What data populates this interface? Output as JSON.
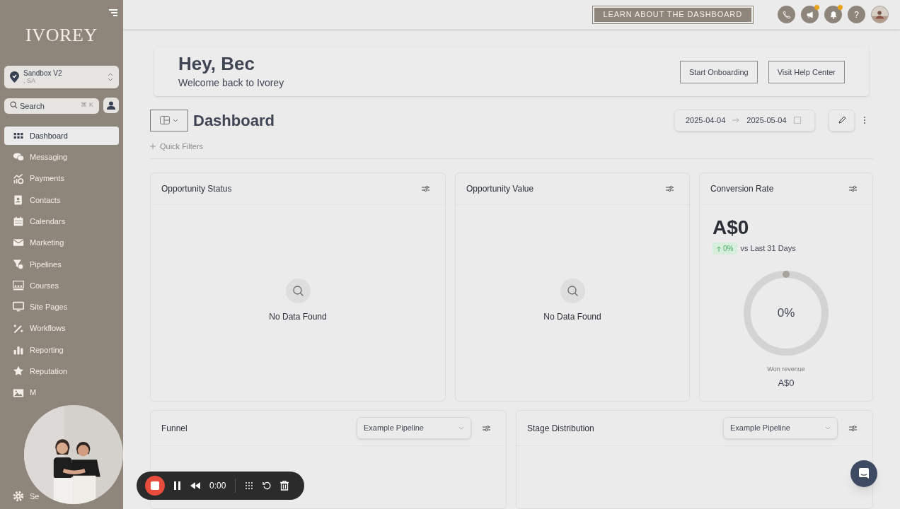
{
  "sidebar": {
    "logo": "IVOREY",
    "account": {
      "name": "Sandbox V2",
      "location": ", SA"
    },
    "search": {
      "placeholder": "Search",
      "shortcut": "⌘ K"
    },
    "items": [
      {
        "label": "Dashboard",
        "selected": true
      },
      {
        "label": "Messaging",
        "selected": false
      },
      {
        "label": "Payments",
        "selected": false
      },
      {
        "label": "Contacts",
        "selected": false
      },
      {
        "label": "Calendars",
        "selected": false
      },
      {
        "label": "Marketing",
        "selected": false
      },
      {
        "label": "Pipelines",
        "selected": false
      },
      {
        "label": "Courses",
        "selected": false
      },
      {
        "label": "Site Pages",
        "selected": false
      },
      {
        "label": "Workflows",
        "selected": false
      },
      {
        "label": "Reporting",
        "selected": false
      },
      {
        "label": "Reputation",
        "selected": false
      },
      {
        "label": "M",
        "selected": false
      }
    ],
    "settings": "Se"
  },
  "topbar": {
    "learn_button": "LEARN ABOUT THE DASHBOARD",
    "icons": [
      {
        "kind": "phone",
        "badge": false
      },
      {
        "kind": "megaphone",
        "badge": true
      },
      {
        "kind": "bell",
        "badge": true
      },
      {
        "kind": "help",
        "badge": false
      },
      {
        "kind": "avatar",
        "badge": false
      }
    ],
    "help_text": "?"
  },
  "welcome": {
    "title": "Hey, Bec",
    "subtitle": "Welcome back to Ivorey",
    "buttons": [
      "Start Onboarding",
      "Visit Help Center"
    ]
  },
  "dashboard": {
    "title": "Dashboard",
    "date_from": "2025-04-04",
    "date_to": "2025-05-04",
    "quick_filters": "Quick Filters"
  },
  "cards": [
    {
      "kind": "empty",
      "title": "Opportunity Status",
      "message": "No Data Found"
    },
    {
      "kind": "empty",
      "title": "Opportunity Value",
      "message": "No Data Found"
    },
    {
      "kind": "rate",
      "title": "Conversion Rate",
      "value": "A$0",
      "change": "0%",
      "comparison": "vs Last 31 Days",
      "center": "0%",
      "caption": "Won revenue",
      "caption_value": "A$0"
    }
  ],
  "lower_cards": [
    {
      "title": "Funnel",
      "select": "Example Pipeline"
    },
    {
      "title": "Stage Distribution",
      "select": "Example Pipeline"
    }
  ],
  "recorder": {
    "time": "0:00"
  }
}
